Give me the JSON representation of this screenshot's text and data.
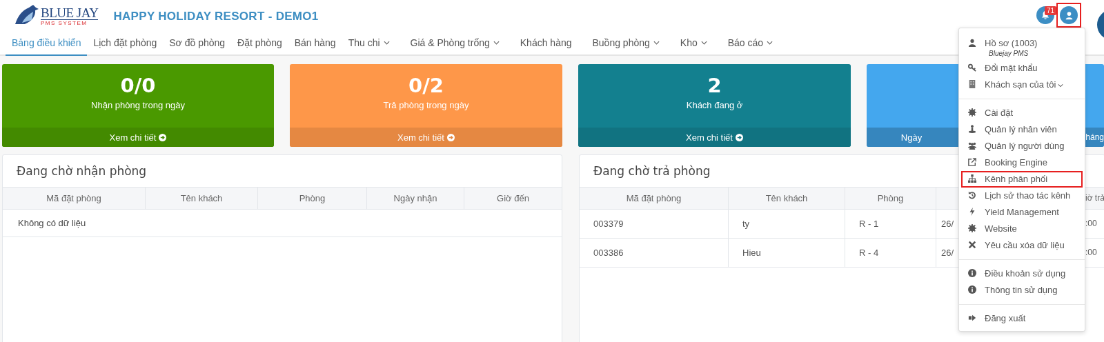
{
  "header": {
    "logo": {
      "name": "BLUE JAY",
      "tagline": "PMS SYSTEM"
    },
    "title": "HAPPY HOLIDAY RESORT - DEMO1",
    "notifications": {
      "count": "71"
    },
    "user_button": {
      "highlighted": true
    }
  },
  "nav": [
    {
      "label": "Bảng điều khiển",
      "selected": true,
      "has_menu": false
    },
    {
      "label": "Lịch đặt phòng",
      "selected": false,
      "has_menu": false
    },
    {
      "label": "Sơ đồ phòng",
      "selected": false,
      "has_menu": false
    },
    {
      "label": "Đặt phòng",
      "selected": false,
      "has_menu": false
    },
    {
      "label": "Bán hàng",
      "selected": false,
      "has_menu": false
    },
    {
      "label": "Thu chi",
      "selected": false,
      "has_menu": true
    },
    {
      "label": "Giá & Phòng trống",
      "selected": false,
      "has_menu": true
    },
    {
      "label": "Khách hàng",
      "selected": false,
      "has_menu": false
    },
    {
      "label": "Buồng phòng",
      "selected": false,
      "has_menu": true
    },
    {
      "label": "Kho",
      "selected": false,
      "has_menu": true
    },
    {
      "label": "Báo cáo",
      "selected": false,
      "has_menu": true
    }
  ],
  "stats": [
    {
      "value": "0/0",
      "label": "Nhận phòng trong ngày",
      "footer": [
        "Xem chi tiết"
      ],
      "color": "#4a9900"
    },
    {
      "value": "0/2",
      "label": "Trả phòng trong ngày",
      "footer": [
        "Xem chi tiết"
      ],
      "color": "#fe9749"
    },
    {
      "value": "2",
      "label": "Khách đang ở",
      "footer": [
        "Xem chi tiết"
      ],
      "color": "#13808f"
    },
    {
      "footer": [
        "Ngày",
        "háng"
      ],
      "color": "#44a7ee"
    }
  ],
  "panels": [
    {
      "title": "Đang chờ nhận phòng",
      "columns": [
        "Mã đặt phòng",
        "Tên khách",
        "Phòng",
        "Ngày nhận",
        "Giờ đến"
      ],
      "empty": "Không có dữ liệu"
    },
    {
      "title": "Đang chờ trả phòng",
      "columns": [
        "Mã đặt phòng",
        "Tên khách",
        "Phòng",
        "",
        "iờ trả"
      ],
      "rows": [
        [
          "003379",
          "ty",
          "R - 1",
          "26/",
          ":00"
        ],
        [
          "003386",
          "Hieu",
          "R - 4",
          "26/",
          ":00"
        ]
      ]
    }
  ],
  "user_menu": [
    [
      {
        "label": "Hồ sơ (1003)",
        "subtitle": "Bluejay PMS",
        "has_menu": false,
        "highlighted": false
      },
      {
        "label": "Đổi mật khẩu",
        "has_menu": false,
        "highlighted": false
      },
      {
        "label": "Khách sạn của tôi",
        "has_menu": true,
        "highlighted": false
      }
    ],
    [
      {
        "label": "Cài đặt",
        "has_menu": false,
        "highlighted": false
      },
      {
        "label": "Quản lý nhân viên",
        "has_menu": false,
        "highlighted": false
      },
      {
        "label": "Quản lý người dùng",
        "has_menu": false,
        "highlighted": false
      },
      {
        "label": "Booking Engine",
        "has_menu": false,
        "highlighted": false
      },
      {
        "label": "Kênh phân phối",
        "has_menu": false,
        "highlighted": true
      },
      {
        "label": "Lịch sử thao tác kênh",
        "has_menu": false,
        "highlighted": false
      },
      {
        "label": "Yield Management",
        "has_menu": false,
        "highlighted": false
      },
      {
        "label": "Website",
        "has_menu": false,
        "highlighted": false
      },
      {
        "label": "Yêu cầu xóa dữ liệu",
        "has_menu": false,
        "highlighted": false
      }
    ],
    [
      {
        "label": "Điều khoản sử dụng",
        "has_menu": false,
        "highlighted": false
      },
      {
        "label": "Thông tin sử dụng",
        "has_menu": false,
        "highlighted": false
      }
    ],
    [
      {
        "label": "Đăng xuất",
        "has_menu": false,
        "highlighted": false
      }
    ]
  ]
}
